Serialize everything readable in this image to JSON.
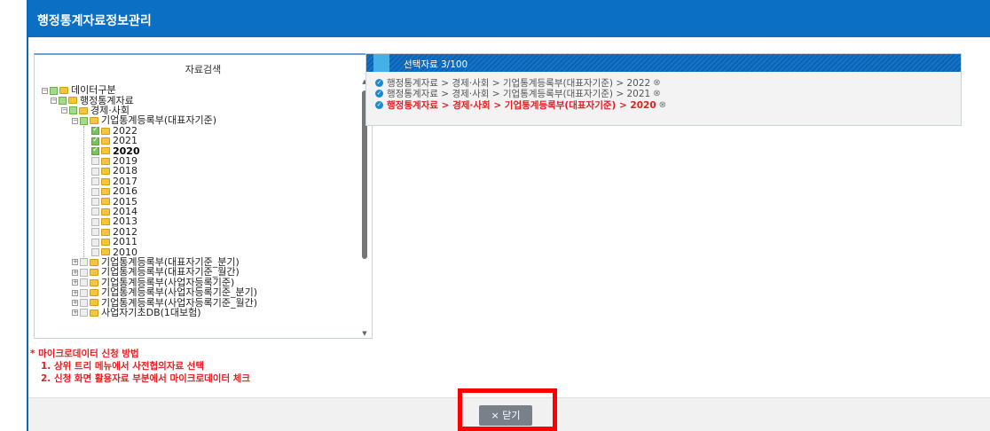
{
  "window": {
    "title": "행정통계자료정보관리"
  },
  "left_panel": {
    "title": "자료검색",
    "tree": {
      "root": "데이터구분",
      "level1": "행정통계자료",
      "level2": "경제·사회",
      "level3": "기업통계등록부(대표자기준)",
      "years": [
        "2022",
        "2021",
        "2020",
        "2019",
        "2018",
        "2017",
        "2016",
        "2015",
        "2014",
        "2013",
        "2012",
        "2011",
        "2010"
      ],
      "checked_years": [
        "2022",
        "2021",
        "2020"
      ],
      "bold_year": "2020",
      "siblings": [
        "기업통계등록부(대표자기준_분기)",
        "기업통계등록부(대표자기준_월간)",
        "기업통계등록부(사업자등록기준)",
        "기업통계등록부(사업자등록기준_분기)",
        "기업통계등록부(사업자등록기준_월간)",
        "사업자기초DB(1대보험)"
      ]
    }
  },
  "notes": {
    "heading": "* 마이크로데이터 신청 방법",
    "step1": "1. 상위 트리 메뉴에서 사전협의자료 선택",
    "step2": "2. 신청 화면 활용자료 부분에서 마이크로데이터 체크"
  },
  "right_panel": {
    "title": "선택자료 3/100",
    "items": [
      {
        "path": "행정통계자료 > 경제·사회 > 기업통계등록부(대표자기준) > 2022",
        "active": false
      },
      {
        "path": "행정통계자료 > 경제·사회 > 기업통계등록부(대표자기준) > 2021",
        "active": false
      },
      {
        "path": "행정통계자료 > 경제·사회 > 기업통계등록부(대표자기준) > 2020",
        "active": true
      }
    ]
  },
  "footer": {
    "close_label": "× 닫기"
  },
  "colors": {
    "accent": "#0b6fc3",
    "highlight": "#ff0000",
    "note_red": "#e02020"
  }
}
